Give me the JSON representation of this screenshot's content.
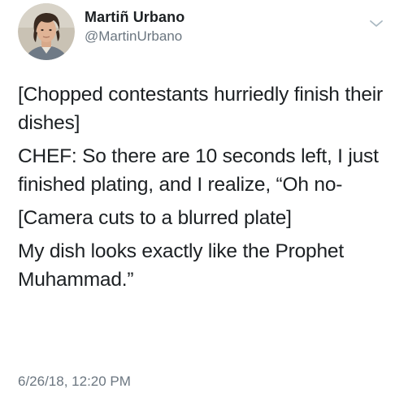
{
  "author": {
    "display_name": "Martiñ Urbano",
    "handle": "@MartinUrbano"
  },
  "tweet": {
    "paragraphs": [
      "[Chopped contestants hurriedly finish their dishes]",
      "CHEF: So there are 10 seconds left, I just finished plating, and I realize, “Oh no-",
      "[Camera cuts to a blurred plate]",
      "My dish looks exactly like the Prophet Muhammad.”"
    ],
    "timestamp": "6/26/18, 12:20 PM"
  },
  "icons": {
    "menu": "chevron-down-icon",
    "avatar": "profile-photo"
  },
  "colors": {
    "text": "#1c2023",
    "secondary_text": "#6b7680",
    "caret": "#aab8c2"
  }
}
